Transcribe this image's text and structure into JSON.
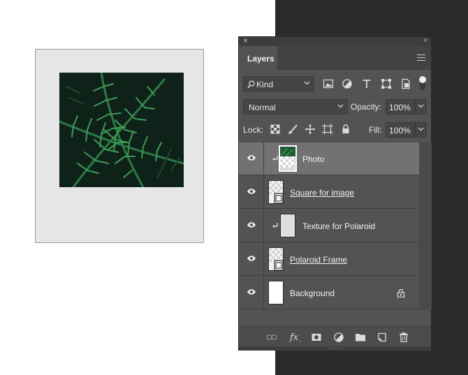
{
  "panel": {
    "tab_label": "Layers",
    "close_glyph": "×",
    "collapse_glyph": "‹‹"
  },
  "filter": {
    "kind_label": "Kind",
    "icons": [
      "image-filter-icon",
      "adjustment-filter-icon",
      "type-filter-icon",
      "shape-filter-icon",
      "smart-object-filter-icon"
    ]
  },
  "blend": {
    "mode": "Normal",
    "opacity_label": "Opacity:",
    "opacity_value": "100%",
    "lock_label": "Lock:",
    "fill_label": "Fill:",
    "fill_value": "100%"
  },
  "layers": [
    {
      "name": "Photo",
      "selected": true,
      "clipped": true,
      "smart": false,
      "locked": false
    },
    {
      "name": "Square for image",
      "selected": false,
      "clipped": false,
      "smart": true,
      "locked": false
    },
    {
      "name": "Texture for Polaroid",
      "selected": false,
      "clipped": true,
      "smart": false,
      "locked": false
    },
    {
      "name": "Polaroid Frame",
      "selected": false,
      "clipped": false,
      "smart": true,
      "locked": false
    },
    {
      "name": "Background",
      "selected": false,
      "clipped": false,
      "smart": false,
      "locked": true
    }
  ],
  "colors": {
    "panel_bg": "#535353",
    "selected_row": "#727272",
    "workspace_dark": "#2b2b2b",
    "fern_green": "#2f7a44"
  }
}
